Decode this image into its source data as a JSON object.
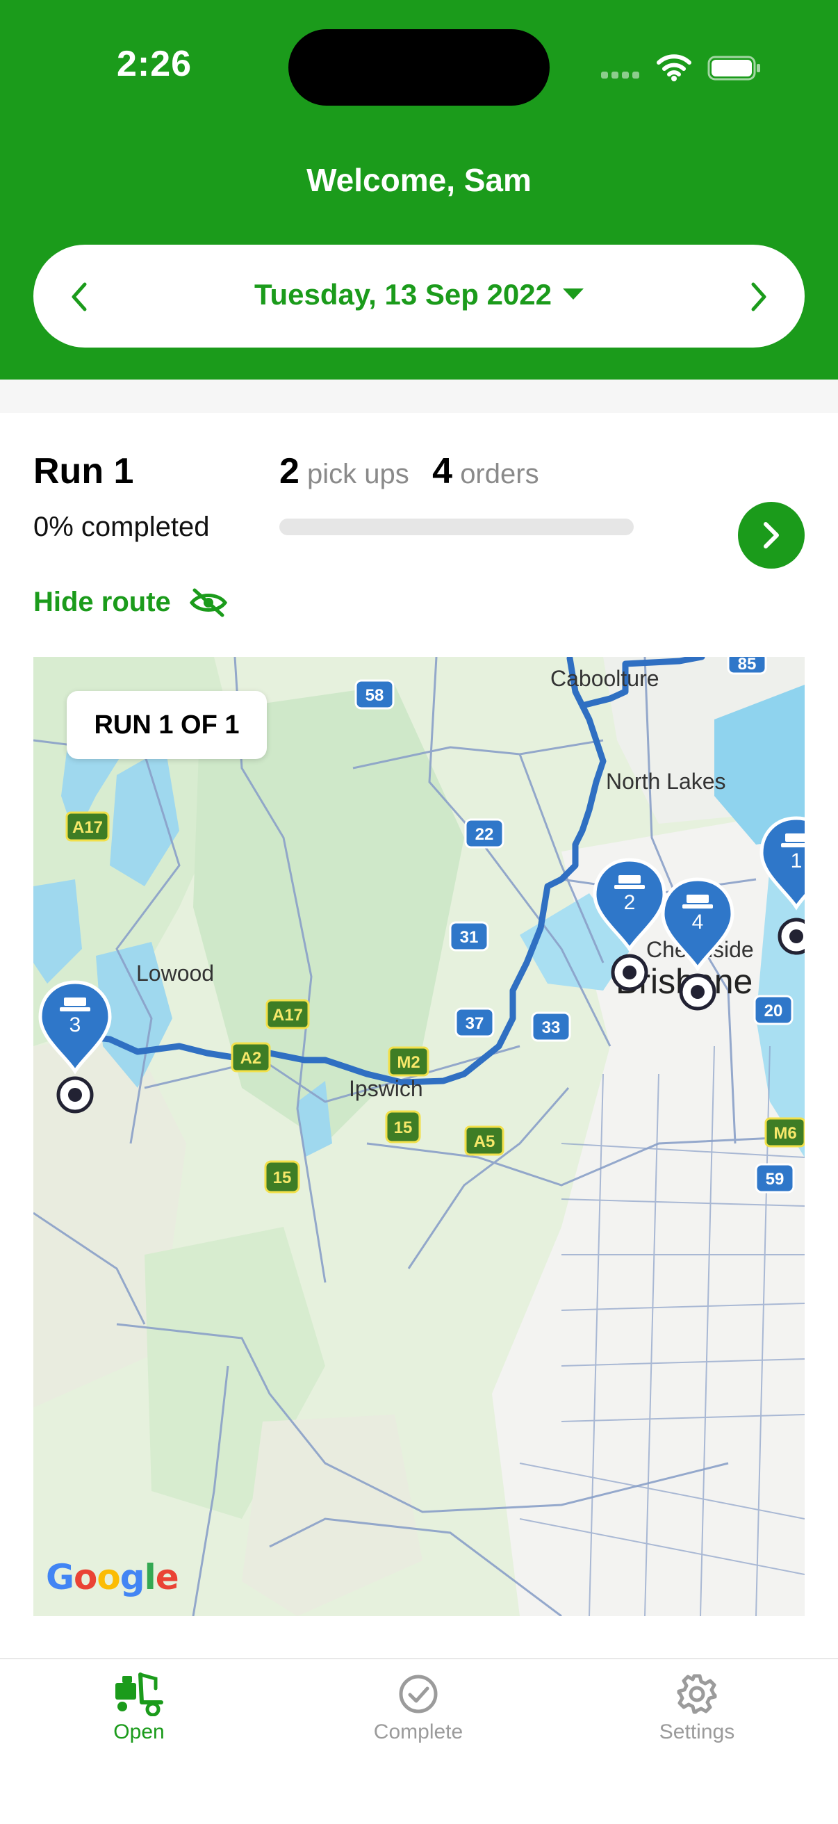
{
  "status_bar": {
    "time": "2:26"
  },
  "header": {
    "welcome": "Welcome, Sam",
    "date": "Tuesday, 13 Sep 2022"
  },
  "run": {
    "title": "Run 1",
    "completed_label": "0% completed",
    "completed_fraction": 0,
    "pickups_count": "2",
    "pickups_label": "pick ups",
    "orders_count": "4",
    "orders_label": "orders",
    "hide_route_label": "Hide route"
  },
  "map": {
    "run_badge": "RUN 1 OF 1",
    "places": [
      "Caboolture",
      "North Lakes",
      "Chermside",
      "Brisbane",
      "Lowood",
      "Ipswich"
    ],
    "road_shields": [
      "85",
      "58",
      "A17",
      "22",
      "31",
      "A17",
      "37",
      "33",
      "20",
      "A2",
      "M2",
      "15",
      "A5",
      "M6",
      "15",
      "59"
    ],
    "markers": [
      "1",
      "2",
      "3",
      "4"
    ],
    "attribution": "Google"
  },
  "tabs": [
    {
      "label": "Open",
      "icon": "truck-icon",
      "active": true
    },
    {
      "label": "Complete",
      "icon": "check-circle-icon",
      "active": false
    },
    {
      "label": "Settings",
      "icon": "gear-icon",
      "active": false
    }
  ],
  "colors": {
    "brand_green": "#1b9b1b",
    "route_blue": "#2f6fc2",
    "marker_blue": "#2f77c9"
  }
}
